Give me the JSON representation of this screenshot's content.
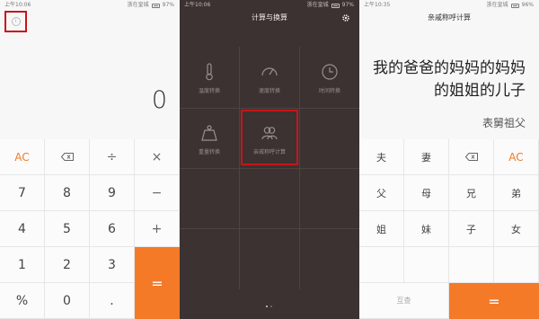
{
  "status_bars": [
    {
      "time": "上午10:06",
      "carrier": "浙在皇城",
      "battery": "97%"
    },
    {
      "time": "上午10:06",
      "carrier": "浙在皇城",
      "battery": "97%"
    },
    {
      "time": "上午10:35",
      "carrier": "浙在皇城",
      "battery": "96%"
    }
  ],
  "calculator": {
    "display": "0",
    "keys": [
      "AC",
      "⌫",
      "÷",
      "×",
      "7",
      "8",
      "9",
      "−",
      "4",
      "5",
      "6",
      "+",
      "1",
      "2",
      "3",
      "%",
      "0",
      ".",
      "="
    ]
  },
  "conversion_menu": {
    "title": "计算与换算",
    "items": [
      {
        "label": "温度转换",
        "icon": "thermometer-icon"
      },
      {
        "label": "速度转换",
        "icon": "speedometer-icon"
      },
      {
        "label": "时间转换",
        "icon": "clock-icon"
      },
      {
        "label": "重量转换",
        "icon": "weight-icon"
      },
      {
        "label": "亲戚称呼计算",
        "icon": "people-icon"
      }
    ]
  },
  "relative_calculator": {
    "title": "亲戚称呼计算",
    "expression": "我的爸爸的妈妈的妈妈的姐姐的儿子",
    "result": "表舅祖父",
    "keys": [
      "夫",
      "妻",
      "⌫",
      "AC",
      "父",
      "母",
      "兄",
      "弟",
      "姐",
      "妹",
      "子",
      "女",
      "互查",
      "="
    ]
  },
  "colors": {
    "accent": "#f47a28",
    "highlight": "#c8141a",
    "menu_bg": "#3b3231"
  }
}
